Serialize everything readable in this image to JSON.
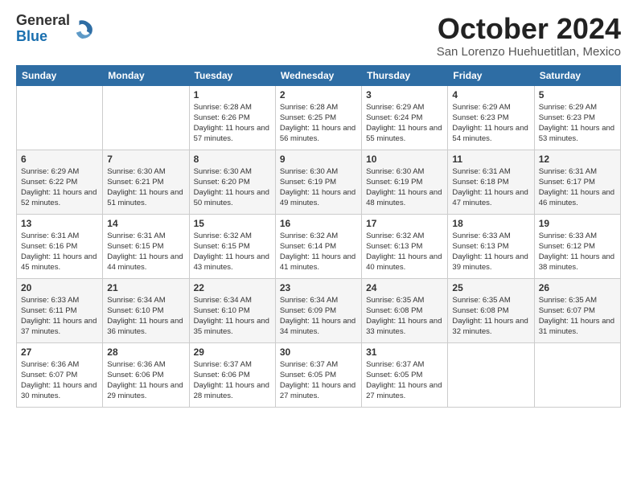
{
  "logo": {
    "general": "General",
    "blue": "Blue"
  },
  "title": "October 2024",
  "location": "San Lorenzo Huehuetitlan, Mexico",
  "days_of_week": [
    "Sunday",
    "Monday",
    "Tuesday",
    "Wednesday",
    "Thursday",
    "Friday",
    "Saturday"
  ],
  "weeks": [
    [
      {
        "day": "",
        "info": ""
      },
      {
        "day": "",
        "info": ""
      },
      {
        "day": "1",
        "info": "Sunrise: 6:28 AM\nSunset: 6:26 PM\nDaylight: 11 hours and 57 minutes."
      },
      {
        "day": "2",
        "info": "Sunrise: 6:28 AM\nSunset: 6:25 PM\nDaylight: 11 hours and 56 minutes."
      },
      {
        "day": "3",
        "info": "Sunrise: 6:29 AM\nSunset: 6:24 PM\nDaylight: 11 hours and 55 minutes."
      },
      {
        "day": "4",
        "info": "Sunrise: 6:29 AM\nSunset: 6:23 PM\nDaylight: 11 hours and 54 minutes."
      },
      {
        "day": "5",
        "info": "Sunrise: 6:29 AM\nSunset: 6:23 PM\nDaylight: 11 hours and 53 minutes."
      }
    ],
    [
      {
        "day": "6",
        "info": "Sunrise: 6:29 AM\nSunset: 6:22 PM\nDaylight: 11 hours and 52 minutes."
      },
      {
        "day": "7",
        "info": "Sunrise: 6:30 AM\nSunset: 6:21 PM\nDaylight: 11 hours and 51 minutes."
      },
      {
        "day": "8",
        "info": "Sunrise: 6:30 AM\nSunset: 6:20 PM\nDaylight: 11 hours and 50 minutes."
      },
      {
        "day": "9",
        "info": "Sunrise: 6:30 AM\nSunset: 6:19 PM\nDaylight: 11 hours and 49 minutes."
      },
      {
        "day": "10",
        "info": "Sunrise: 6:30 AM\nSunset: 6:19 PM\nDaylight: 11 hours and 48 minutes."
      },
      {
        "day": "11",
        "info": "Sunrise: 6:31 AM\nSunset: 6:18 PM\nDaylight: 11 hours and 47 minutes."
      },
      {
        "day": "12",
        "info": "Sunrise: 6:31 AM\nSunset: 6:17 PM\nDaylight: 11 hours and 46 minutes."
      }
    ],
    [
      {
        "day": "13",
        "info": "Sunrise: 6:31 AM\nSunset: 6:16 PM\nDaylight: 11 hours and 45 minutes."
      },
      {
        "day": "14",
        "info": "Sunrise: 6:31 AM\nSunset: 6:15 PM\nDaylight: 11 hours and 44 minutes."
      },
      {
        "day": "15",
        "info": "Sunrise: 6:32 AM\nSunset: 6:15 PM\nDaylight: 11 hours and 43 minutes."
      },
      {
        "day": "16",
        "info": "Sunrise: 6:32 AM\nSunset: 6:14 PM\nDaylight: 11 hours and 41 minutes."
      },
      {
        "day": "17",
        "info": "Sunrise: 6:32 AM\nSunset: 6:13 PM\nDaylight: 11 hours and 40 minutes."
      },
      {
        "day": "18",
        "info": "Sunrise: 6:33 AM\nSunset: 6:13 PM\nDaylight: 11 hours and 39 minutes."
      },
      {
        "day": "19",
        "info": "Sunrise: 6:33 AM\nSunset: 6:12 PM\nDaylight: 11 hours and 38 minutes."
      }
    ],
    [
      {
        "day": "20",
        "info": "Sunrise: 6:33 AM\nSunset: 6:11 PM\nDaylight: 11 hours and 37 minutes."
      },
      {
        "day": "21",
        "info": "Sunrise: 6:34 AM\nSunset: 6:10 PM\nDaylight: 11 hours and 36 minutes."
      },
      {
        "day": "22",
        "info": "Sunrise: 6:34 AM\nSunset: 6:10 PM\nDaylight: 11 hours and 35 minutes."
      },
      {
        "day": "23",
        "info": "Sunrise: 6:34 AM\nSunset: 6:09 PM\nDaylight: 11 hours and 34 minutes."
      },
      {
        "day": "24",
        "info": "Sunrise: 6:35 AM\nSunset: 6:08 PM\nDaylight: 11 hours and 33 minutes."
      },
      {
        "day": "25",
        "info": "Sunrise: 6:35 AM\nSunset: 6:08 PM\nDaylight: 11 hours and 32 minutes."
      },
      {
        "day": "26",
        "info": "Sunrise: 6:35 AM\nSunset: 6:07 PM\nDaylight: 11 hours and 31 minutes."
      }
    ],
    [
      {
        "day": "27",
        "info": "Sunrise: 6:36 AM\nSunset: 6:07 PM\nDaylight: 11 hours and 30 minutes."
      },
      {
        "day": "28",
        "info": "Sunrise: 6:36 AM\nSunset: 6:06 PM\nDaylight: 11 hours and 29 minutes."
      },
      {
        "day": "29",
        "info": "Sunrise: 6:37 AM\nSunset: 6:06 PM\nDaylight: 11 hours and 28 minutes."
      },
      {
        "day": "30",
        "info": "Sunrise: 6:37 AM\nSunset: 6:05 PM\nDaylight: 11 hours and 27 minutes."
      },
      {
        "day": "31",
        "info": "Sunrise: 6:37 AM\nSunset: 6:05 PM\nDaylight: 11 hours and 27 minutes."
      },
      {
        "day": "",
        "info": ""
      },
      {
        "day": "",
        "info": ""
      }
    ]
  ]
}
